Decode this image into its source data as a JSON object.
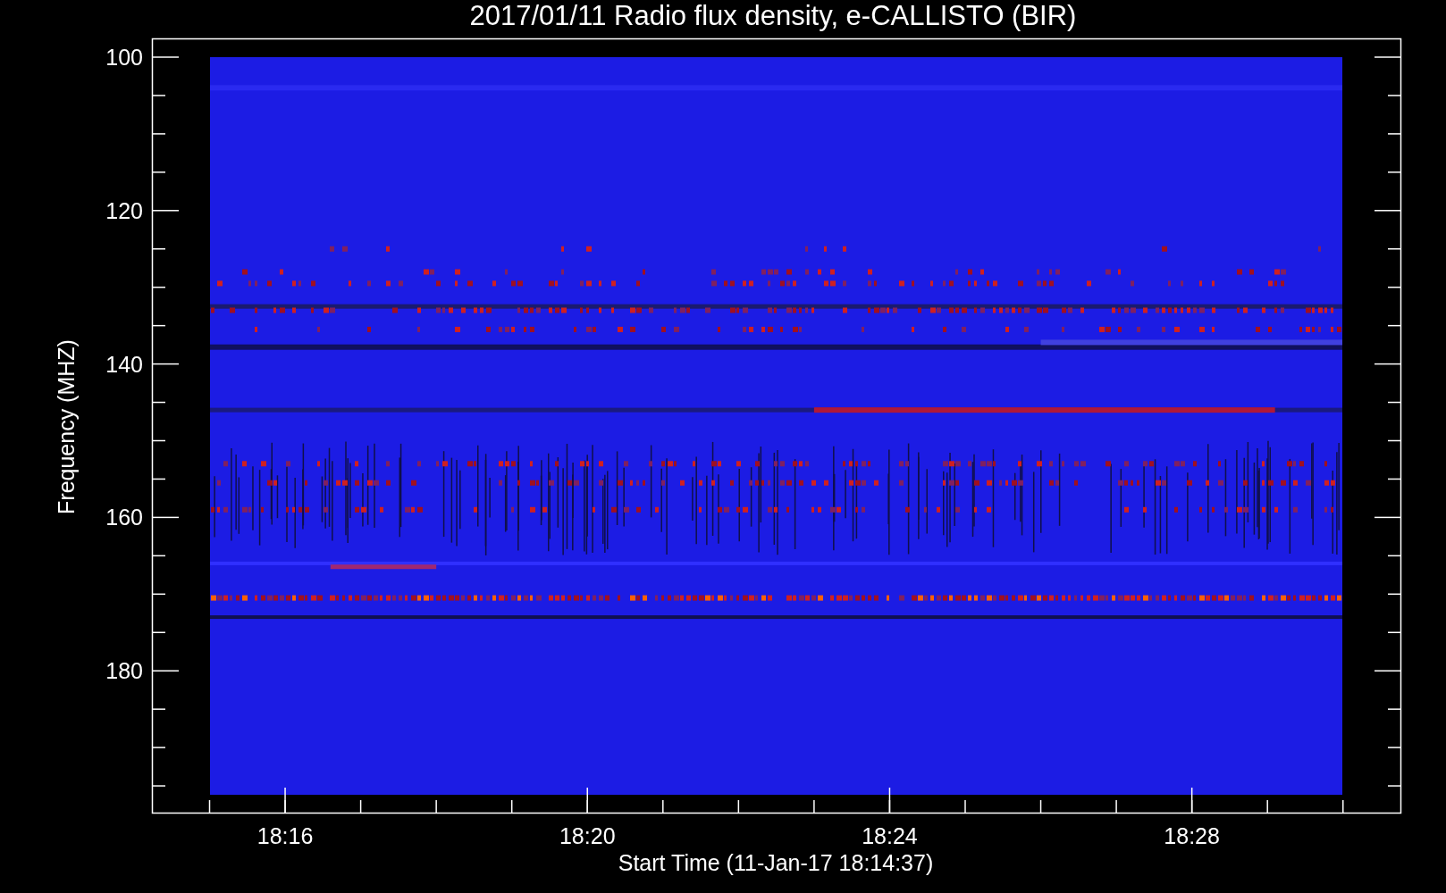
{
  "plot": {
    "title": "2017/01/11  Radio flux density, e-CALLISTO (BIR)",
    "xlabel": "Start Time (11-Jan-17 18:14:37)",
    "ylabel": "Frequency (MHZ)",
    "x_tick_labels": [
      "18:16",
      "18:20",
      "18:24",
      "18:28"
    ],
    "y_tick_labels": [
      "100",
      "120",
      "140",
      "160",
      "180"
    ]
  }
}
